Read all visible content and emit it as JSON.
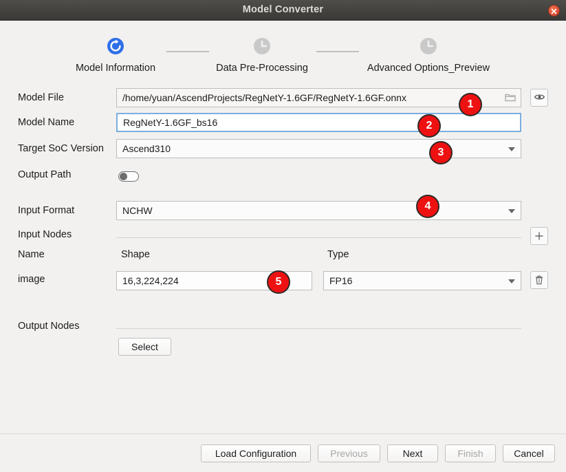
{
  "window": {
    "title": "Model Converter",
    "close_icon": "close-icon"
  },
  "stepper": {
    "steps": [
      {
        "label": "Model Information",
        "icon": "refresh-circle-icon",
        "state": "active"
      },
      {
        "label": "Data Pre-Processing",
        "icon": "clock-icon",
        "state": "pending"
      },
      {
        "label": "Advanced Options_Preview",
        "icon": "clock-icon",
        "state": "pending"
      }
    ]
  },
  "form": {
    "model_file": {
      "label": "Model File",
      "value": "/home/yuan/AscendProjects/RegNetY-1.6GF/RegNetY-1.6GF.onnx",
      "browse_icon": "folder-icon",
      "preview_icon": "eye-icon"
    },
    "model_name": {
      "label": "Model Name",
      "value": "RegNetY-1.6GF_bs16"
    },
    "target_soc": {
      "label": "Target SoC Version",
      "value": "Ascend310"
    },
    "output_path": {
      "label": "Output Path",
      "toggle_state": "off"
    },
    "input_format": {
      "label": "Input Format",
      "value": "NCHW"
    },
    "input_nodes": {
      "label": "Input Nodes",
      "add_icon": "plus-icon",
      "columns": [
        "Name",
        "Shape",
        "Type"
      ],
      "rows": [
        {
          "name": "image",
          "shape": "16,3,224,224",
          "type": "FP16",
          "delete_icon": "trash-icon"
        }
      ]
    },
    "output_nodes": {
      "label": "Output Nodes",
      "select_label": "Select"
    }
  },
  "footer": {
    "load_configuration": "Load Configuration",
    "previous": "Previous",
    "next": "Next",
    "finish": "Finish",
    "cancel": "Cancel"
  },
  "annotations": {
    "badges": [
      "1",
      "2",
      "3",
      "4",
      "5"
    ]
  },
  "colors": {
    "accent_blue": "#2f6fe8",
    "badge_red": "#ee1111",
    "focus_border": "#7aaede",
    "titlebar": "#45433f"
  }
}
